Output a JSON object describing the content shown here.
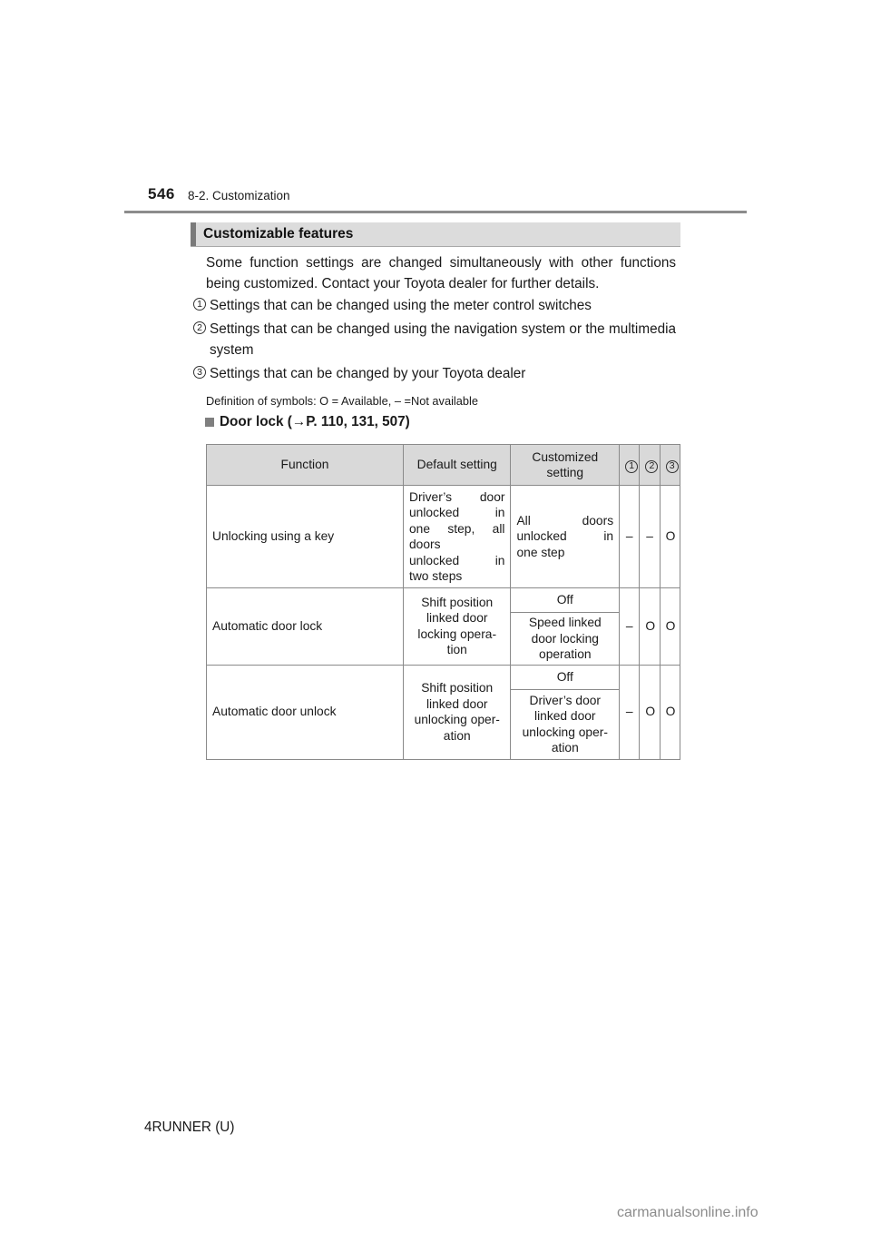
{
  "header": {
    "page_number": "546",
    "section": "8-2. Customization"
  },
  "section_heading": "Customizable features",
  "intro": "Some function settings are changed simultaneously with other functions being customized. Contact your Toyota dealer for further details.",
  "legend": [
    {
      "num": "1",
      "text": "Settings that can be changed using the meter control switches"
    },
    {
      "num": "2",
      "text": "Settings that can be changed using the navigation system or the multimedia system"
    },
    {
      "num": "3",
      "text": "Settings that can be changed by your Toyota dealer"
    }
  ],
  "symbols_definition": "Definition of symbols: O = Available, – =Not available",
  "subsection": {
    "title": "Door lock (",
    "arrow": "→",
    "refs": "P. 110, 131, 507)"
  },
  "table": {
    "headers": {
      "function": "Function",
      "default": "Default setting",
      "customized_line1": "Customized",
      "customized_line2": "setting",
      "col1": "1",
      "col2": "2",
      "col3": "3"
    },
    "rows": [
      {
        "function": "Unlocking using a key",
        "default_lines": [
          "Driver’s door",
          "unlocked in",
          "one step, all",
          "doors",
          "unlocked in",
          "two steps"
        ],
        "customized": [
          {
            "lines": [
              "All doors",
              "unlocked in",
              "one step"
            ]
          }
        ],
        "marks": [
          "–",
          "–",
          "O"
        ]
      },
      {
        "function": "Automatic door lock",
        "default_lines": [
          "Shift position",
          "linked door",
          "locking opera-",
          "tion"
        ],
        "customized": [
          {
            "lines": [
              "Off"
            ]
          },
          {
            "lines": [
              "Speed linked",
              "door locking",
              "operation"
            ]
          }
        ],
        "marks": [
          "–",
          "O",
          "O"
        ]
      },
      {
        "function": "Automatic door unlock",
        "default_lines": [
          "Shift position",
          "linked door",
          "unlocking oper-",
          "ation"
        ],
        "customized": [
          {
            "lines": [
              "Off"
            ]
          },
          {
            "lines": [
              "Driver’s door",
              "linked door",
              "unlocking oper-",
              "ation"
            ]
          }
        ],
        "marks": [
          "–",
          "O",
          "O"
        ]
      }
    ]
  },
  "footer": {
    "model": "4RUNNER (U)"
  },
  "watermark": "carmanualsonline.info"
}
